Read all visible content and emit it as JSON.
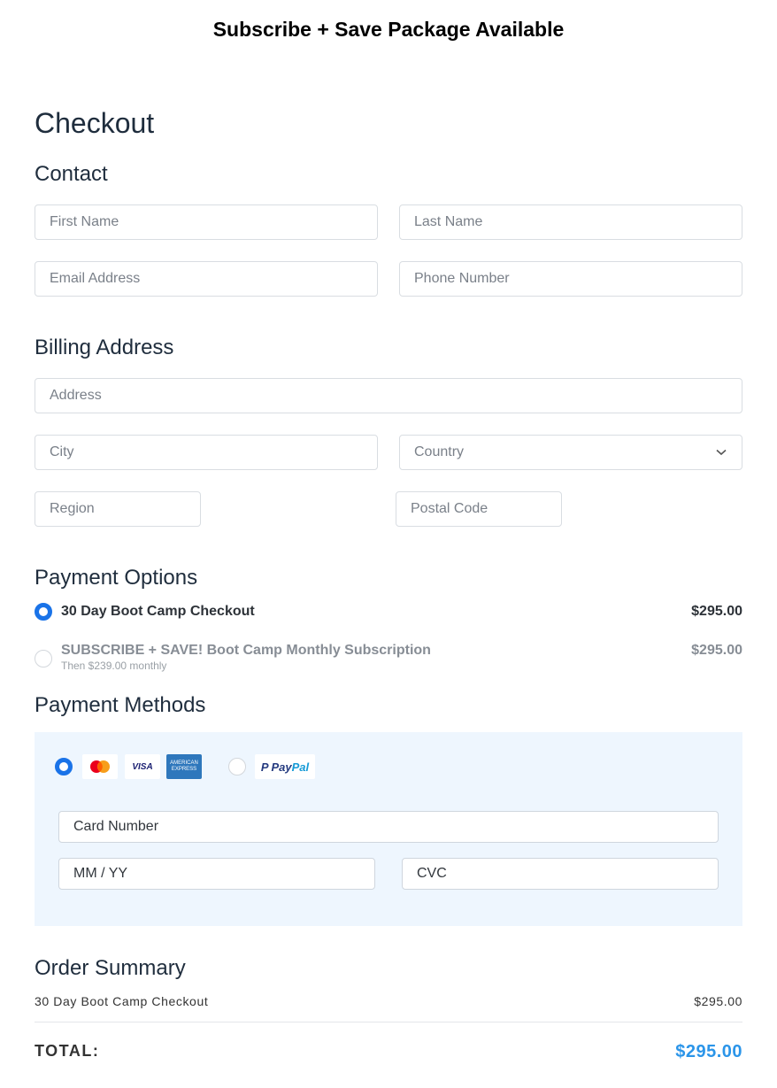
{
  "banner": "Subscribe + Save Package Available",
  "checkout_title": "Checkout",
  "contact": {
    "heading": "Contact",
    "first_name_placeholder": "First Name",
    "last_name_placeholder": "Last Name",
    "email_placeholder": "Email Address",
    "phone_placeholder": "Phone Number"
  },
  "billing": {
    "heading": "Billing Address",
    "address_placeholder": "Address",
    "city_placeholder": "City",
    "country_placeholder": "Country",
    "region_placeholder": "Region",
    "postal_placeholder": "Postal Code"
  },
  "payment_options": {
    "heading": "Payment Options",
    "options": [
      {
        "title": "30 Day Boot Camp Checkout",
        "subtitle": "",
        "price": "$295.00",
        "selected": true
      },
      {
        "title": "SUBSCRIBE + SAVE! Boot Camp Monthly Subscription",
        "subtitle": "Then $239.00 monthly",
        "price": "$295.00",
        "selected": false
      }
    ]
  },
  "payment_methods": {
    "heading": "Payment Methods",
    "card_selected": true,
    "visa_label": "VISA",
    "amex_label": "AMERICAN EXPRESS",
    "paypal_label_1": "Pay",
    "paypal_label_2": "Pal",
    "card_number_placeholder": "Card Number",
    "expiry_placeholder": "MM / YY",
    "cvc_placeholder": "CVC",
    "colors": {
      "panel_bg": "#eef6fe",
      "selected_radio": "#1a73e8",
      "paypal_dark": "#253b80",
      "paypal_light": "#179bd7",
      "amex": "#2e77bc"
    }
  },
  "order_summary": {
    "heading": "Order Summary",
    "line_item": "30 Day Boot Camp Checkout",
    "line_price": "$295.00",
    "total_label": "TOTAL:",
    "total_value": "$295.00",
    "total_color": "#2b95e9"
  }
}
